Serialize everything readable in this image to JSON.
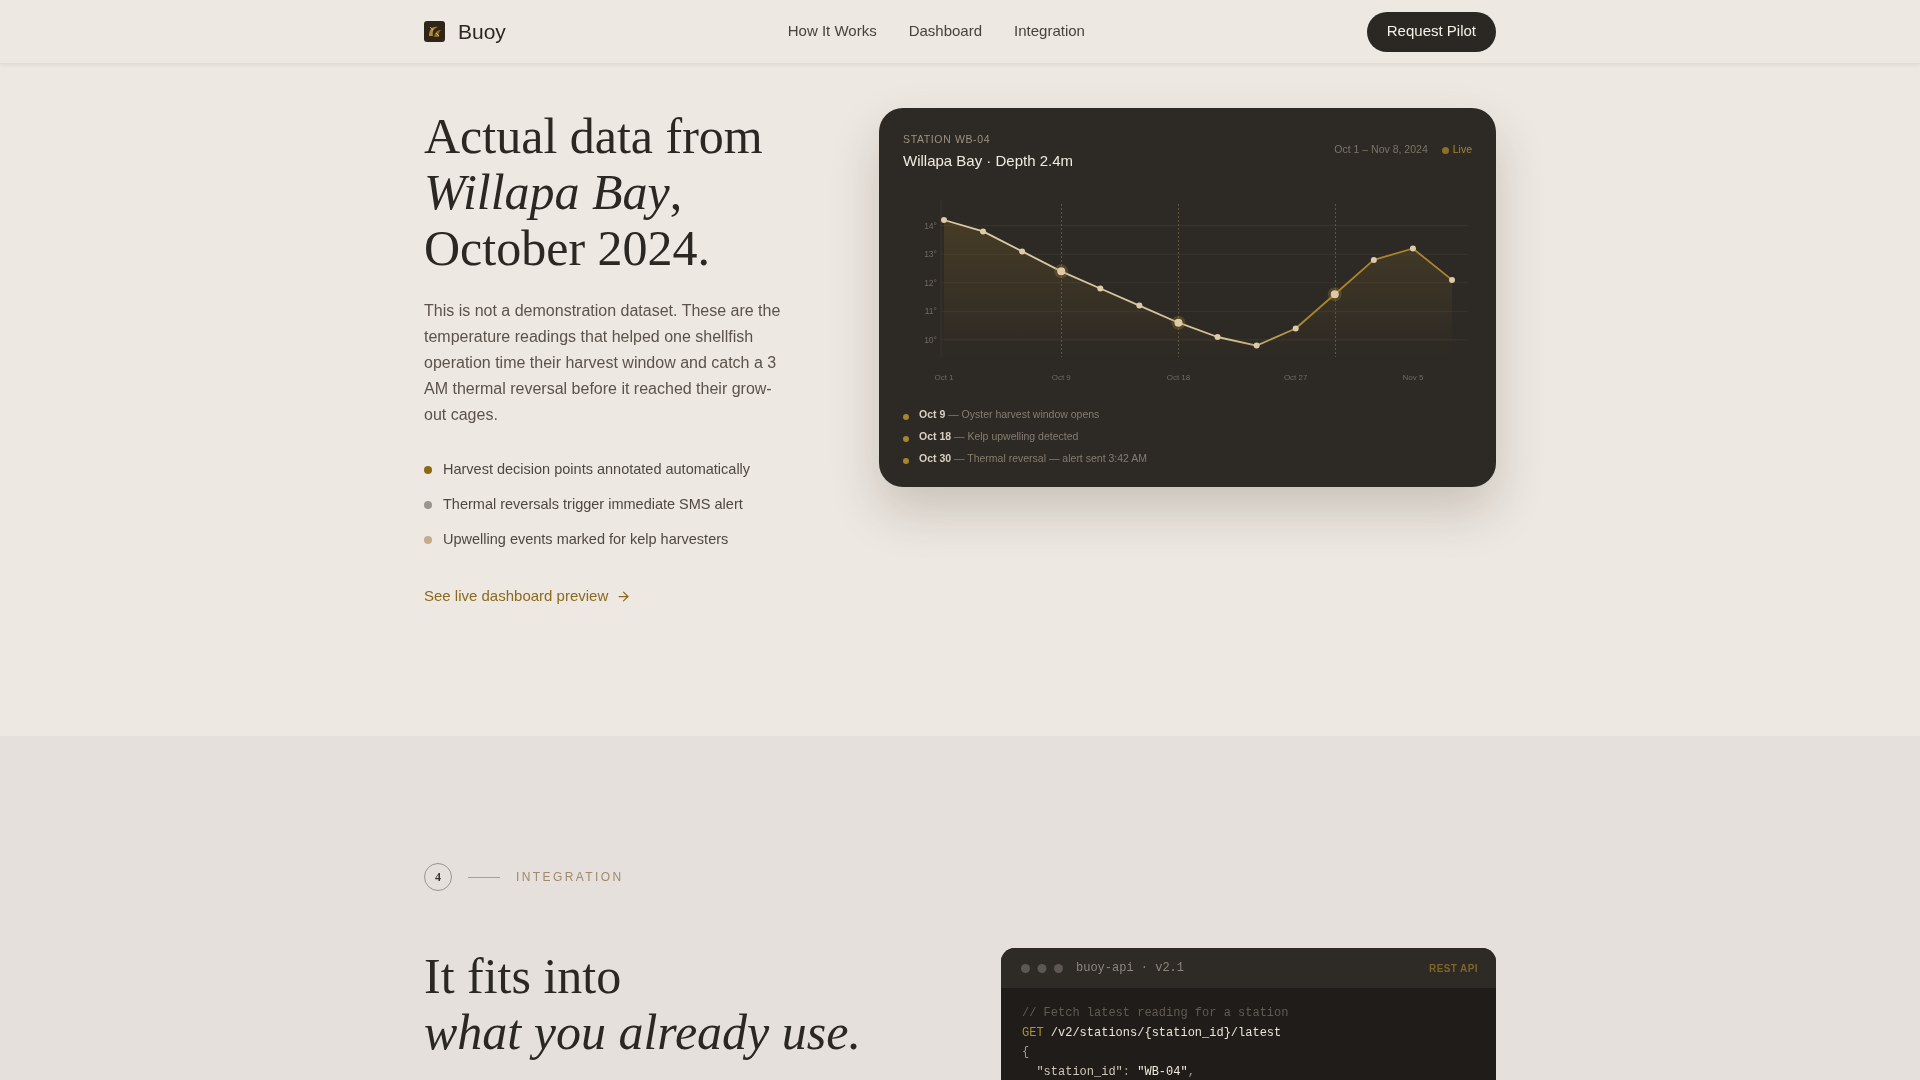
{
  "nav": {
    "brand": "Buoy",
    "links": [
      {
        "label": "How It Works"
      },
      {
        "label": "Dashboard"
      },
      {
        "label": "Integration"
      }
    ],
    "cta": "Request Pilot"
  },
  "hero": {
    "heading": [
      "Actual data from",
      "*Willapa Bay*,",
      "October 2024."
    ],
    "paragraph": "This is not a demonstration dataset. These are the temperature readings that helped one shellfish operation time their harvest window and catch a 3 AM thermal reversal before it reached their grow-out cages.",
    "features": [
      {
        "text": "Harvest decision points annotated automatically",
        "color": "#8b6914"
      },
      {
        "text": "Thermal reversals trigger immediate SMS alert",
        "color": "#9b958d"
      },
      {
        "text": "Upwelling events marked for kelp harvesters",
        "color": "#c5ab8c"
      }
    ],
    "link": "See live dashboard preview"
  },
  "station_card": {
    "eyebrow": "STATION WB-04",
    "title": "Willapa Bay · Depth 2.4m",
    "date_range": "Oct 1 – Nov 8, 2024",
    "status": "Live",
    "chart_data": {
      "type": "area",
      "categories": [
        "Oct 1",
        null,
        null,
        "Oct 9",
        null,
        null,
        "Oct 18",
        null,
        null,
        "Oct 27",
        null,
        null,
        "Nov 5",
        null
      ],
      "values": [
        14.2,
        13.8,
        13.1,
        12.4,
        11.8,
        11.2,
        10.6,
        10.1,
        9.8,
        10.4,
        11.6,
        12.8,
        13.2,
        12.1
      ],
      "color": "#a8842e",
      "yticks": [
        {
          "value": 10,
          "label": "10°"
        },
        {
          "value": 11,
          "label": "11°"
        },
        {
          "value": 12,
          "label": "12°"
        },
        {
          "value": 13,
          "label": "13°"
        },
        {
          "value": 14,
          "label": "14°"
        }
      ],
      "ylim": [
        9.4,
        14.9
      ],
      "grid": true,
      "marker": "circle"
    },
    "events": [
      {
        "date": "Oct 9",
        "description": "— Oyster harvest window opens"
      },
      {
        "date": "Oct 18",
        "description": "— Kelp upwelling detected"
      },
      {
        "date": "Oct 30",
        "description": "— Thermal reversal — alert sent 3:42 AM"
      }
    ]
  },
  "integration": {
    "number": "4",
    "eyebrow": "INTEGRATION",
    "heading": [
      "It fits into",
      "*what you already use.*"
    ],
    "code_window": {
      "title": "buoy-api · v2.1",
      "badge": "REST API",
      "lines": [
        [
          {
            "kind": "comment",
            "text": "// Fetch latest reading for a station"
          }
        ],
        [
          {
            "kind": "method",
            "text": "GET"
          },
          {
            "kind": "path",
            "text": " /v2/stations/{station_id}/latest"
          }
        ],
        [
          {
            "kind": "punct",
            "text": "{"
          }
        ],
        [
          {
            "kind": "key",
            "text": "  \"station_id\""
          },
          {
            "kind": "punct",
            "text": ": "
          },
          {
            "kind": "string",
            "text": "\"WB-04\""
          },
          {
            "kind": "punct",
            "text": ","
          }
        ]
      ]
    }
  }
}
